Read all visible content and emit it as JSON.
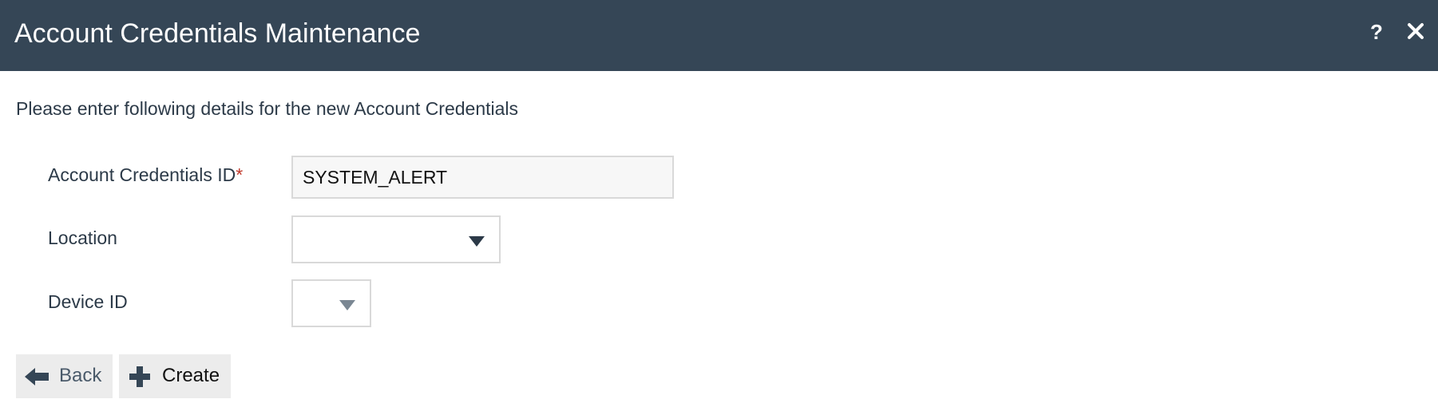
{
  "dialog": {
    "title": "Account Credentials Maintenance",
    "help_label": "?",
    "close_icon": "close-icon"
  },
  "form": {
    "instructions": "Please enter following details for the new Account Credentials",
    "account_id": {
      "label": "Account Credentials ID",
      "required_marker": "*",
      "value": "SYSTEM_ALERT"
    },
    "location": {
      "label": "Location",
      "value": ""
    },
    "device_id": {
      "label": "Device ID",
      "value": ""
    }
  },
  "buttons": {
    "back_label": "Back",
    "back_icon": "arrow-left-icon",
    "create_label": "Create",
    "create_icon": "plus-icon"
  },
  "colors": {
    "header_bg": "#354656",
    "required": "#c0392b",
    "button_bg": "#ececec"
  }
}
